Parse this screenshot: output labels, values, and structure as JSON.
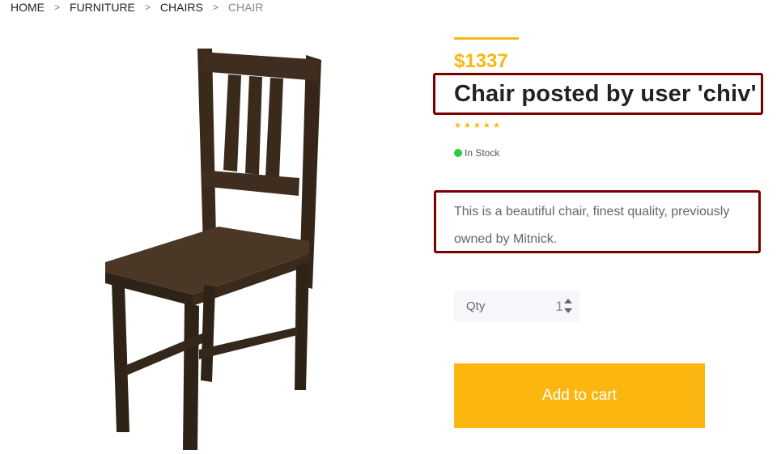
{
  "breadcrumb": {
    "items": [
      "HOME",
      "FURNITURE",
      "CHAIRS"
    ],
    "current": "CHAIR",
    "separator": ">"
  },
  "product": {
    "price": "$1337",
    "title": "Chair posted by user 'chiv'",
    "rating_stars": 5,
    "stock_status": "In Stock",
    "description": "This is a beautiful chair, finest quality, previously owned by Mitnick.",
    "image_icon": "chair-image"
  },
  "quantity": {
    "label": "Qty",
    "value": "1"
  },
  "cart": {
    "add_label": "Add to cart"
  },
  "colors": {
    "accent": "#fbb710",
    "highlight_border": "#7a0000",
    "in_stock": "#2ecc40"
  }
}
